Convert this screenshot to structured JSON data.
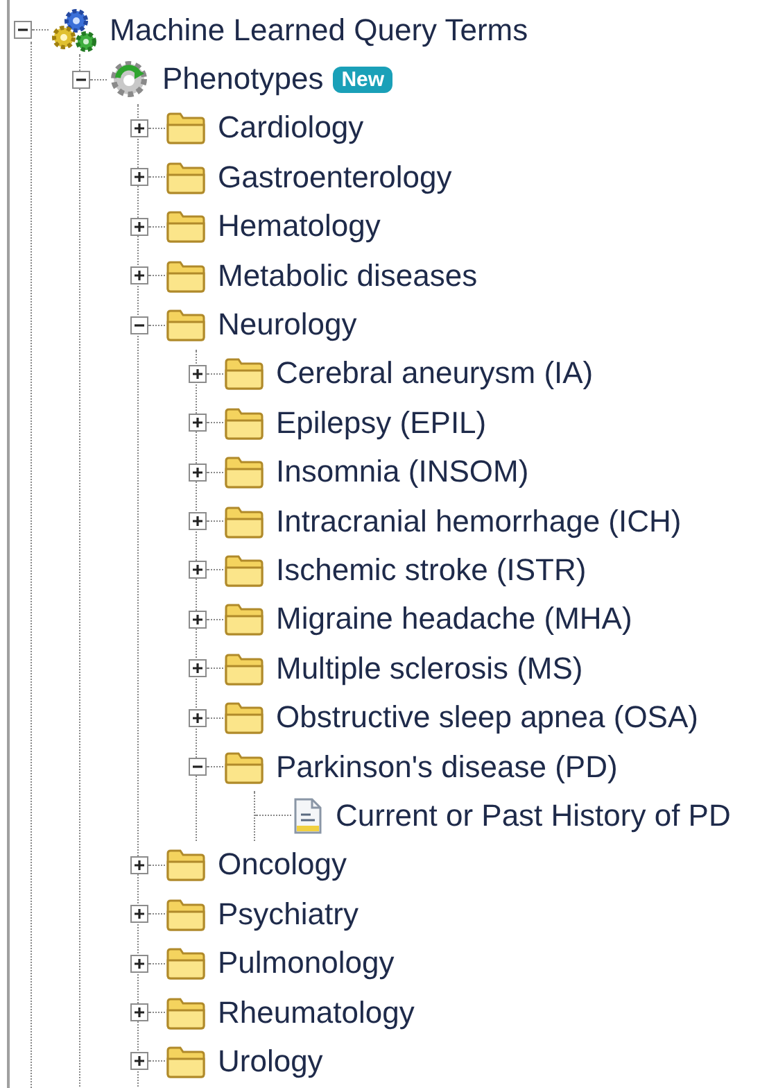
{
  "tree": [
    {
      "label": "Machine Learned Query Terms",
      "kind": "gears",
      "expanded": true,
      "children": [
        {
          "label": "Phenotypes",
          "kind": "phenotype",
          "badge": "New",
          "expanded": true,
          "children": [
            {
              "label": "Cardiology",
              "kind": "folder",
              "expanded": false
            },
            {
              "label": "Gastroenterology",
              "kind": "folder",
              "expanded": false
            },
            {
              "label": "Hematology",
              "kind": "folder",
              "expanded": false
            },
            {
              "label": "Metabolic diseases",
              "kind": "folder",
              "expanded": false
            },
            {
              "label": "Neurology",
              "kind": "folder",
              "expanded": true,
              "children": [
                {
                  "label": "Cerebral aneurysm (IA)",
                  "kind": "folder",
                  "expanded": false
                },
                {
                  "label": "Epilepsy (EPIL)",
                  "kind": "folder",
                  "expanded": false
                },
                {
                  "label": "Insomnia (INSOM)",
                  "kind": "folder",
                  "expanded": false
                },
                {
                  "label": "Intracranial hemorrhage (ICH)",
                  "kind": "folder",
                  "expanded": false
                },
                {
                  "label": "Ischemic stroke (ISTR)",
                  "kind": "folder",
                  "expanded": false
                },
                {
                  "label": "Migraine headache (MHA)",
                  "kind": "folder",
                  "expanded": false
                },
                {
                  "label": "Multiple sclerosis (MS)",
                  "kind": "folder",
                  "expanded": false
                },
                {
                  "label": "Obstructive sleep apnea (OSA)",
                  "kind": "folder",
                  "expanded": false
                },
                {
                  "label": "Parkinson's disease (PD)",
                  "kind": "folder",
                  "expanded": true,
                  "children": [
                    {
                      "label": "Current or Past History of PD",
                      "kind": "document"
                    }
                  ]
                }
              ]
            },
            {
              "label": "Oncology",
              "kind": "folder",
              "expanded": false
            },
            {
              "label": "Psychiatry",
              "kind": "folder",
              "expanded": false
            },
            {
              "label": "Pulmonology",
              "kind": "folder",
              "expanded": false
            },
            {
              "label": "Rheumatology",
              "kind": "folder",
              "expanded": false
            },
            {
              "label": "Urology",
              "kind": "folder",
              "expanded": false
            }
          ]
        }
      ]
    }
  ]
}
